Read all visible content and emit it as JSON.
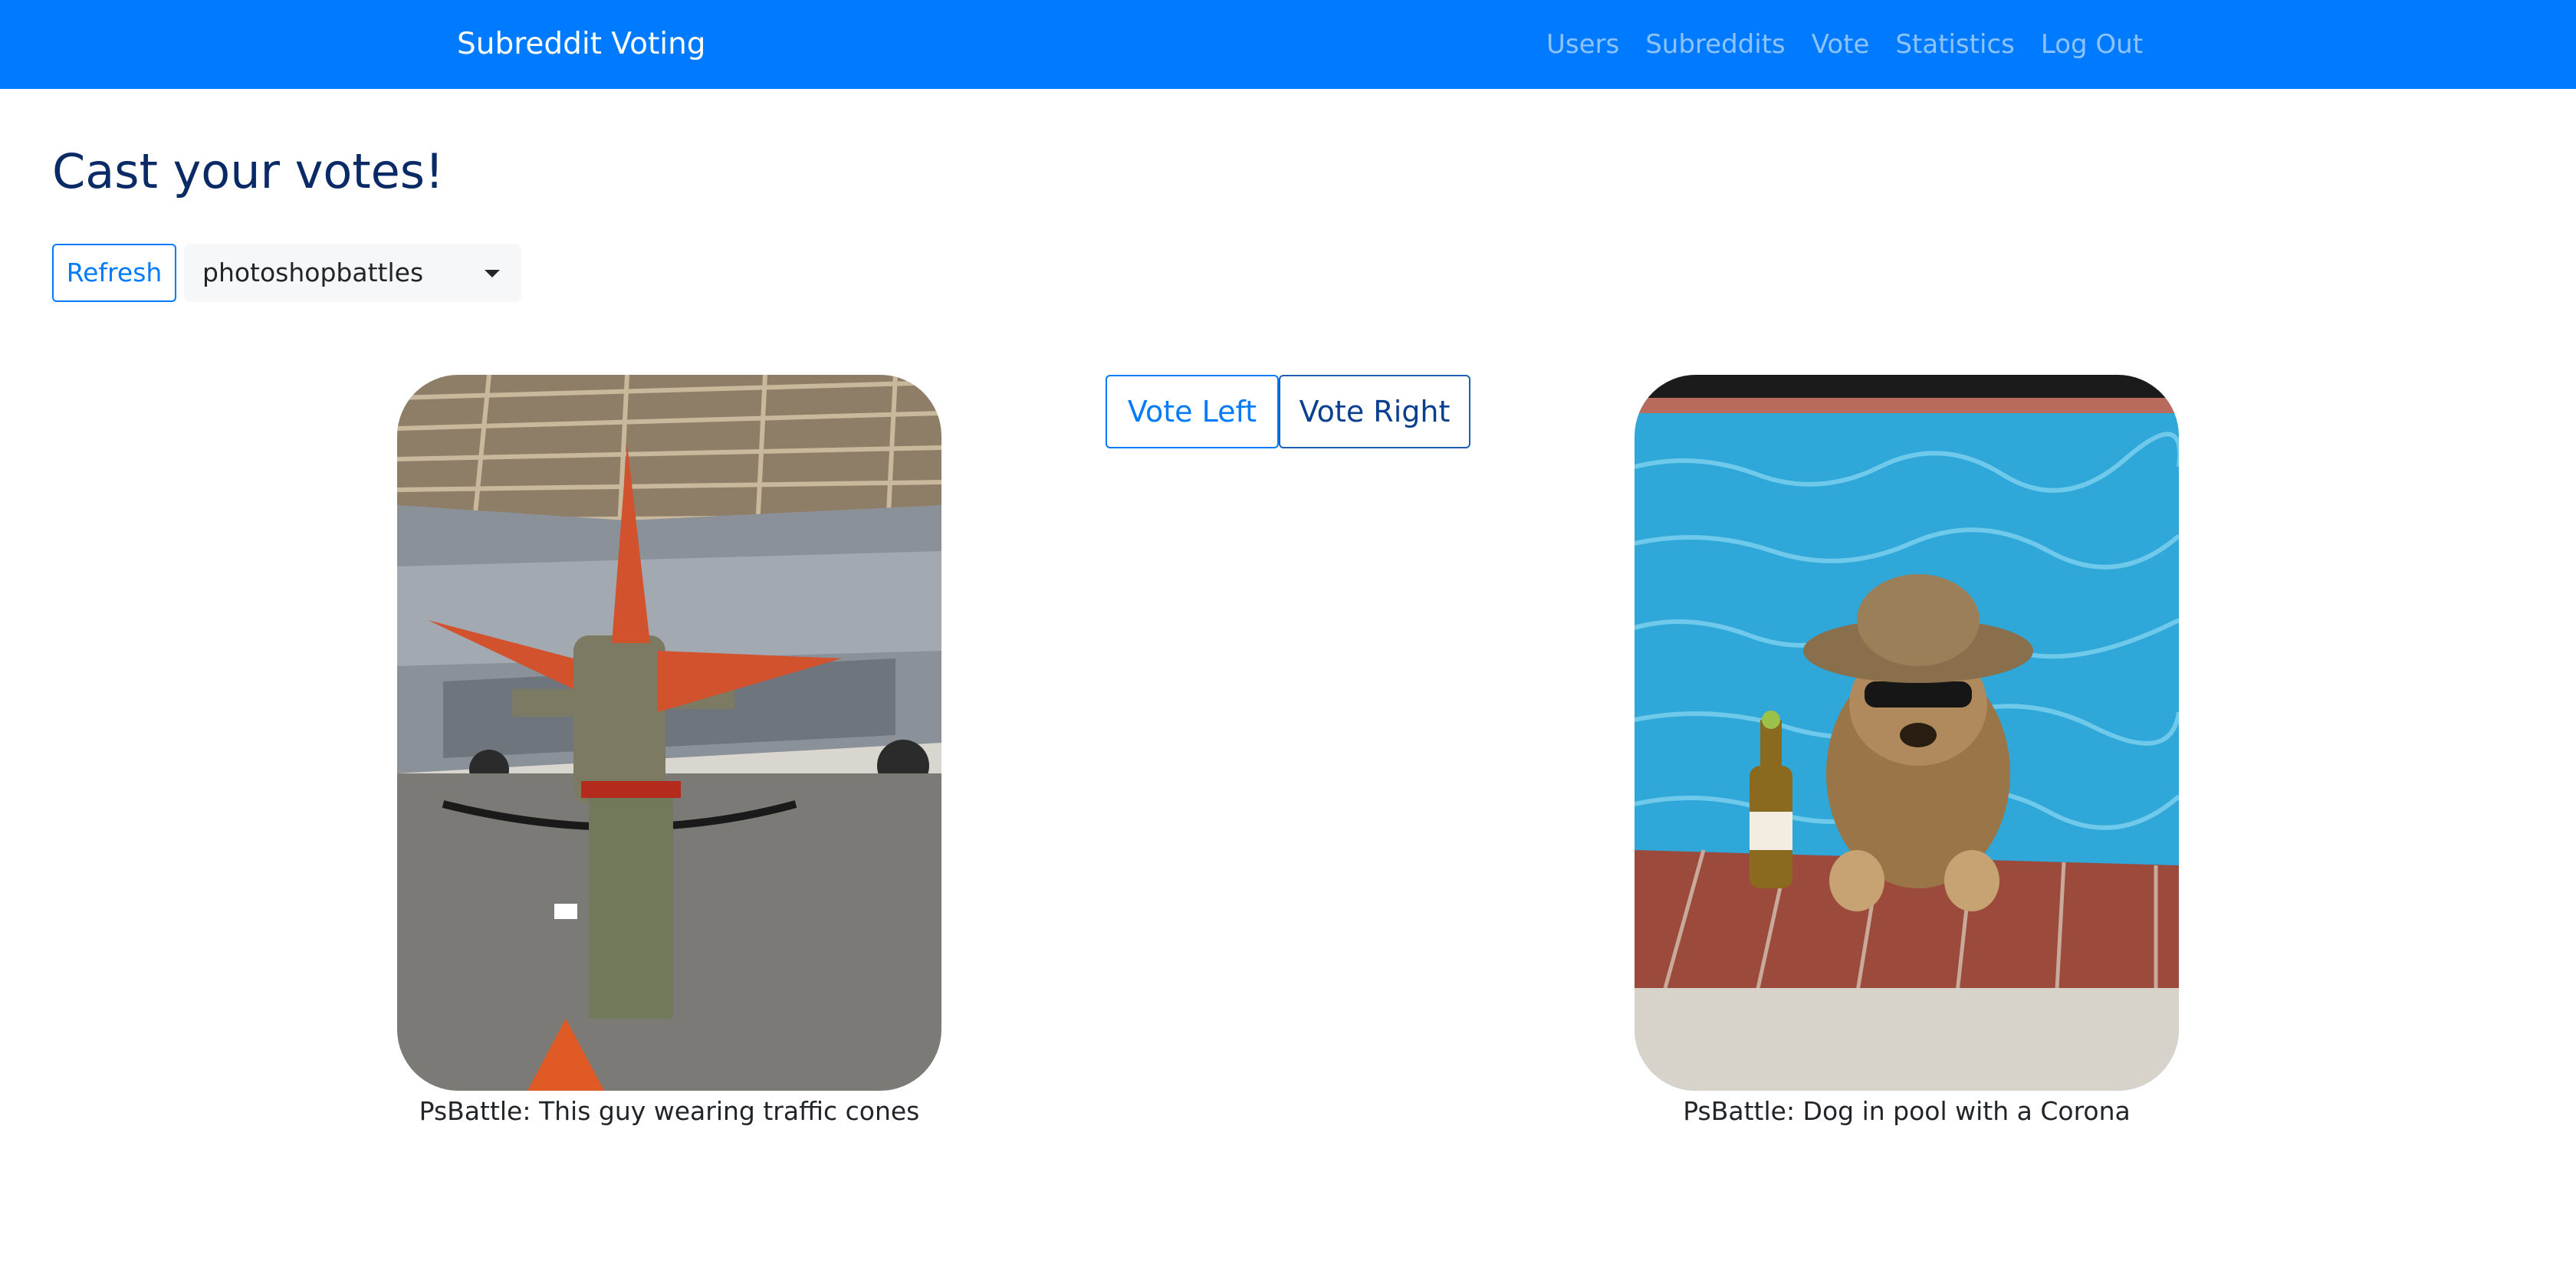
{
  "navbar": {
    "brand": "Subreddit Voting",
    "links": [
      {
        "label": "Users"
      },
      {
        "label": "Subreddits"
      },
      {
        "label": "Vote"
      },
      {
        "label": "Statistics"
      },
      {
        "label": "Log Out"
      }
    ]
  },
  "page": {
    "title": "Cast your votes!"
  },
  "controls": {
    "refresh_label": "Refresh",
    "subreddit_selected": "photoshopbattles"
  },
  "candidates": {
    "left": {
      "caption": "PsBattle: This guy wearing traffic cones",
      "image_subject": "person with traffic cones in front of fighter jet"
    },
    "right": {
      "caption": "PsBattle: Dog in pool with a Corona",
      "image_subject": "dog in pool wearing hat and sunglasses with a bottle"
    }
  },
  "vote": {
    "left_label": "Vote Left",
    "right_label": "Vote Right"
  },
  "colors": {
    "navbar_bg": "#007bff",
    "primary": "#007bff",
    "title": "#0a2a66"
  }
}
